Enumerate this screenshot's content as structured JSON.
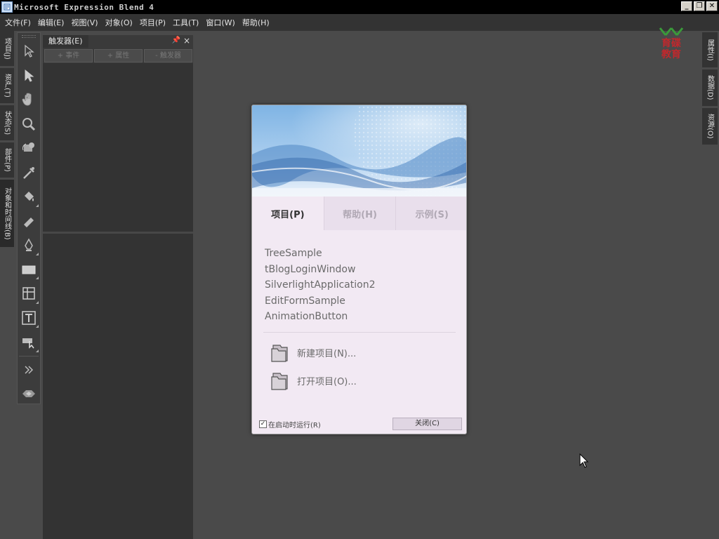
{
  "window": {
    "title": "Microsoft Expression Blend 4",
    "controls": {
      "minimize": "_",
      "restore": "❐",
      "close": "✕"
    }
  },
  "menu": [
    "文件(F)",
    "编辑(E)",
    "视图(V)",
    "对象(O)",
    "项目(P)",
    "工具(T)",
    "窗口(W)",
    "帮助(H)"
  ],
  "left_tabs": [
    "项目(J)",
    "资产(T)",
    "状态(S)",
    "部件(P)",
    "对象和时间线(B)"
  ],
  "right_tabs": [
    "属性(I)",
    "数据(D)",
    "资源(O)"
  ],
  "tools": [
    "selection-icon",
    "direct-selection-icon",
    "pan-icon",
    "zoom-icon",
    "camera-orbit-icon",
    "eyedropper-icon",
    "paint-bucket-icon",
    "gradient-icon",
    "pen-icon",
    "rectangle-icon",
    "grid-icon",
    "text-icon",
    "asset-icon",
    "more-icon",
    "assets-icon"
  ],
  "triggers_panel": {
    "title": "触发器(E)",
    "pin": "📌",
    "close": "×",
    "buttons": [
      "+ 事件",
      "+ 属性",
      "- 触发器"
    ]
  },
  "watermark": {
    "line1": "育碟",
    "line2": "教育"
  },
  "dialog": {
    "tabs": [
      "项目(P)",
      "帮助(H)",
      "示例(S)"
    ],
    "active_tab": 0,
    "recent_projects": [
      "TreeSample",
      "tBlogLoginWindow",
      "SilverlightApplication2",
      "EditFormSample",
      "AnimationButton"
    ],
    "new_project": "新建项目(N)...",
    "open_project": "打开项目(O)...",
    "run_at_startup": "在启动时运行(R)",
    "run_at_startup_checked": true,
    "close_label": "关闭(C)"
  }
}
